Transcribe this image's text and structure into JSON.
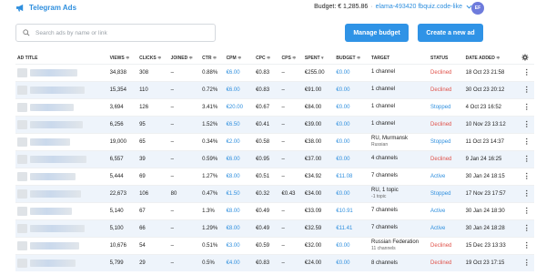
{
  "header": {
    "brand": "Telegram Ads",
    "budget_label": "Budget: € 1,285.86",
    "separator": "·",
    "account": "elama-493420 fbquiz.code-like",
    "avatar_initials": "EF"
  },
  "toolbar": {
    "search_placeholder": "Search ads by name or link",
    "manage_budget": "Manage budget",
    "create_ad": "Create a new ad"
  },
  "columns": {
    "ad_title": "AD TITLE",
    "views": "VIEWS",
    "clicks": "CLICKS",
    "joined": "JOINED",
    "ctr": "CTR",
    "cpm": "CPM",
    "cpc": "CPC",
    "cps": "CPS",
    "spent": "SPENT",
    "budget": "BUDGET",
    "target": "TARGET",
    "status": "STATUS",
    "date_added": "DATE ADDED",
    "sort_asc": "≑",
    "sort_desc": "▾"
  },
  "rows": [
    {
      "views": "34,838",
      "clicks": "308",
      "joined": "–",
      "ctr": "0.88%",
      "cpm": "€6.00",
      "cpc": "€0.83",
      "cps": "–",
      "spent": "€255.00",
      "budget": "€0.00",
      "target": "1 channel",
      "target_sub": "",
      "status": "Declined",
      "status_color": "#e0524a",
      "date": "18 Oct 23 21:58"
    },
    {
      "views": "15,354",
      "clicks": "110",
      "joined": "–",
      "ctr": "0.72%",
      "cpm": "€6.00",
      "cpc": "€0.83",
      "cps": "–",
      "spent": "€91.00",
      "budget": "€0.00",
      "target": "1 channel",
      "target_sub": "",
      "status": "Declined",
      "status_color": "#e0524a",
      "date": "30 Oct 23 20:12"
    },
    {
      "views": "3,694",
      "clicks": "126",
      "joined": "–",
      "ctr": "3.41%",
      "cpm": "€20.00",
      "cpc": "€0.67",
      "cps": "–",
      "spent": "€84.00",
      "budget": "€0.00",
      "target": "1 channel",
      "target_sub": "",
      "status": "Stopped",
      "status_color": "#2f8fde",
      "date": "4 Oct 23 16:52"
    },
    {
      "views": "6,256",
      "clicks": "95",
      "joined": "–",
      "ctr": "1.52%",
      "cpm": "€6.50",
      "cpc": "€0.41",
      "cps": "–",
      "spent": "€39.00",
      "budget": "€0.00",
      "target": "1 channel",
      "target_sub": "",
      "status": "Declined",
      "status_color": "#e0524a",
      "date": "10 Nov 23 13:12"
    },
    {
      "views": "19,000",
      "clicks": "65",
      "joined": "–",
      "ctr": "0.34%",
      "cpm": "€2.00",
      "cpc": "€0.58",
      "cps": "–",
      "spent": "€38.00",
      "budget": "€0.00",
      "target": "RU, Murmansk",
      "target_sub": "Russian",
      "status": "Stopped",
      "status_color": "#2f8fde",
      "date": "11 Oct 23 14:37"
    },
    {
      "views": "6,557",
      "clicks": "39",
      "joined": "–",
      "ctr": "0.59%",
      "cpm": "€6.00",
      "cpc": "€0.95",
      "cps": "–",
      "spent": "€37.00",
      "budget": "€0.00",
      "target": "4 channels",
      "target_sub": "",
      "status": "Declined",
      "status_color": "#e0524a",
      "date": "9 Jan 24 16:25"
    },
    {
      "views": "5,444",
      "clicks": "69",
      "joined": "–",
      "ctr": "1.27%",
      "cpm": "€8.00",
      "cpc": "€0.51",
      "cps": "–",
      "spent": "€34.92",
      "budget": "€11.08",
      "target": "7 channels",
      "target_sub": "",
      "status": "Active",
      "status_color": "#2f8fde",
      "date": "30 Jan 24 18:15"
    },
    {
      "views": "22,673",
      "clicks": "106",
      "joined": "80",
      "ctr": "0.47%",
      "cpm": "€1.50",
      "cpc": "€0.32",
      "cps": "€0.43",
      "spent": "€34.00",
      "budget": "€0.00",
      "target": "RU, 1 topic",
      "target_sub": "-1 topic",
      "status": "Stopped",
      "status_color": "#2f8fde",
      "date": "17 Nov 23 17:57"
    },
    {
      "views": "5,140",
      "clicks": "67",
      "joined": "–",
      "ctr": "1.3%",
      "cpm": "€8.00",
      "cpc": "€0.49",
      "cps": "–",
      "spent": "€33.09",
      "budget": "€10.91",
      "target": "7 channels",
      "target_sub": "",
      "status": "Active",
      "status_color": "#2f8fde",
      "date": "30 Jan 24 18:30"
    },
    {
      "views": "5,100",
      "clicks": "66",
      "joined": "–",
      "ctr": "1.29%",
      "cpm": "€8.00",
      "cpc": "€0.49",
      "cps": "–",
      "spent": "€32.59",
      "budget": "€11.41",
      "target": "7 channels",
      "target_sub": "",
      "status": "Active",
      "status_color": "#2f8fde",
      "date": "30 Jan 24 18:28"
    },
    {
      "views": "10,676",
      "clicks": "54",
      "joined": "–",
      "ctr": "0.51%",
      "cpm": "€3.00",
      "cpc": "€0.59",
      "cps": "–",
      "spent": "€32.00",
      "budget": "€0.00",
      "target": "Russian Federation",
      "target_sub": "11 channels",
      "status": "Declined",
      "status_color": "#e0524a",
      "date": "15 Dec 23 13:33"
    },
    {
      "views": "5,799",
      "clicks": "29",
      "joined": "–",
      "ctr": "0.5%",
      "cpm": "€4.00",
      "cpc": "€0.83",
      "cps": "–",
      "spent": "€24.00",
      "budget": "€0.00",
      "target": "8 channels",
      "target_sub": "",
      "status": "Declined",
      "status_color": "#e0524a",
      "date": "19 Oct 23 17:15"
    }
  ],
  "row_menu": "⋮",
  "icons": {
    "brand": "megaphone-icon",
    "search": "search-icon",
    "settings": "gear-icon",
    "dropdown": "chevron-down-icon"
  }
}
